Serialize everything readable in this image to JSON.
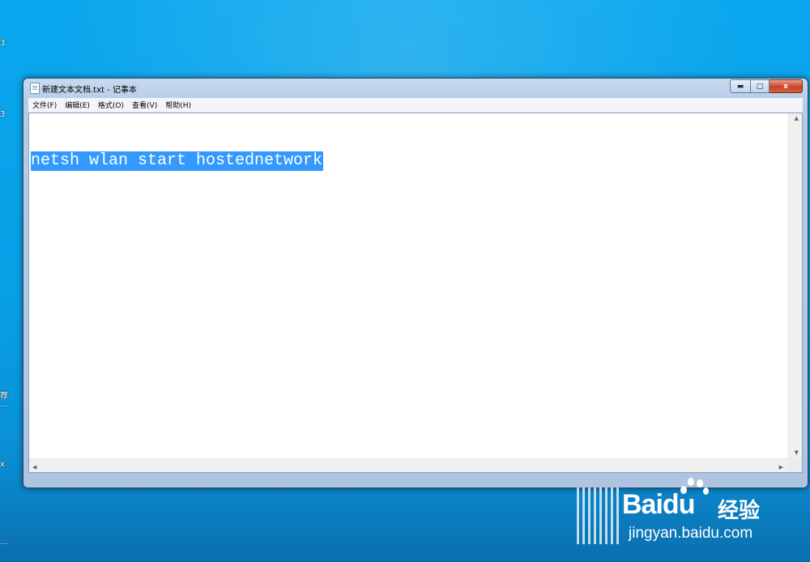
{
  "desktop": {
    "fragments": [
      "3",
      "3",
      "荐",
      "...",
      "x",
      "..."
    ]
  },
  "window": {
    "title": "新建文本文档.txt - 记事本",
    "controls": {
      "minimize": "▬",
      "maximize": "□",
      "close": "x"
    }
  },
  "menu": {
    "items": [
      "文件(F)",
      "编辑(E)",
      "格式(O)",
      "查看(V)",
      "帮助(H)"
    ]
  },
  "editor": {
    "text": "netsh wlan start hostednetwork",
    "selected": true
  },
  "watermark": {
    "logo": "Bai",
    "logo2": "du",
    "cn": "经验",
    "url": "jingyan.baidu.com"
  },
  "colors": {
    "selection": "#3399ff",
    "desktop": "#0aa7ee"
  }
}
